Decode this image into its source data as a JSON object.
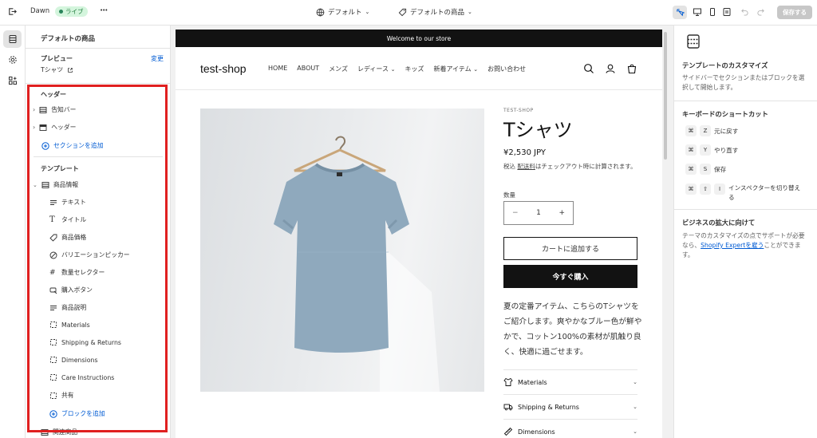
{
  "topbar": {
    "store_name": "Dawn",
    "live_label": "ライブ",
    "more_label": "•••",
    "theme_select": "デフォルト",
    "template_select": "デフォルトの商品",
    "save_label": "保存する"
  },
  "sidebar": {
    "title": "デフォルトの商品",
    "preview_label": "プレビュー",
    "preview_change": "変更",
    "preview_value": "Tシャツ",
    "header_group_label": "ヘッダー",
    "header_items": [
      {
        "label": "告知バー",
        "icon": "section-icon"
      },
      {
        "label": "ヘッダー",
        "icon": "header-section-icon"
      }
    ],
    "add_section_label": "セクションを追加",
    "template_group_label": "テンプレート",
    "product_info_label": "商品情報",
    "blocks": [
      {
        "label": "テキスト",
        "icon": "text-icon"
      },
      {
        "label": "タイトル",
        "icon": "title-icon"
      },
      {
        "label": "商品価格",
        "icon": "price-tag-icon"
      },
      {
        "label": "バリエーションピッカー",
        "icon": "variant-picker-icon"
      },
      {
        "label": "数量セレクター",
        "icon": "hash-icon"
      },
      {
        "label": "購入ボタン",
        "icon": "buy-button-icon"
      },
      {
        "label": "商品説明",
        "icon": "text-icon"
      },
      {
        "label": "Materials",
        "icon": "collapsible-icon"
      },
      {
        "label": "Shipping & Returns",
        "icon": "collapsible-icon"
      },
      {
        "label": "Dimensions",
        "icon": "collapsible-icon"
      },
      {
        "label": "Care Instructions",
        "icon": "collapsible-icon"
      },
      {
        "label": "共有",
        "icon": "collapsible-icon"
      }
    ],
    "add_block_label": "ブロックを追加",
    "related_label": "関連商品"
  },
  "preview": {
    "announcement": "Welcome to our store",
    "shop_name": "test-shop",
    "nav": [
      "HOME",
      "ABOUT",
      "メンズ",
      "レディース",
      "キッズ",
      "新着アイテム",
      "お問い合わせ"
    ],
    "nav_dropdown": [
      false,
      false,
      false,
      true,
      false,
      true,
      false
    ],
    "vendor": "TEST-SHOP",
    "product_title": "Tシャツ",
    "price": "¥2,530 JPY",
    "tax_note_pre": "税込",
    "tax_note_link": "配送料",
    "tax_note_post": "はチェックアウト時に計算されます。",
    "qty_label": "数量",
    "qty_minus": "−",
    "qty_value": "1",
    "qty_plus": "+",
    "add_to_cart": "カートに追加する",
    "buy_now": "今すぐ購入",
    "description": "夏の定番アイテム、こちらのTシャツをご紹介します。爽やかなブルー色が鮮やかで、コットン100%の素材が肌触り良く、快適に過ごせます。",
    "accordions": [
      {
        "label": "Materials",
        "icon": "materials-icon"
      },
      {
        "label": "Shipping & Returns",
        "icon": "truck-icon"
      },
      {
        "label": "Dimensions",
        "icon": "ruler-icon"
      }
    ]
  },
  "right_panel": {
    "customize_title": "テンプレートのカスタマイズ",
    "customize_text": "サイドバーでセクションまたはブロックを選択して開始します。",
    "shortcuts_title": "キーボードのショートカット",
    "shortcuts": [
      {
        "keys": [
          "⌘",
          "Z"
        ],
        "label": "元に戻す"
      },
      {
        "keys": [
          "⌘",
          "Y"
        ],
        "label": "やり直す"
      },
      {
        "keys": [
          "⌘",
          "S"
        ],
        "label": "保存"
      },
      {
        "keys": [
          "⌘",
          "⇧",
          "I"
        ],
        "label": "インスペクターを切り替える"
      }
    ],
    "business_title": "ビジネスの拡大に向けて",
    "business_text_pre": "テーマのカスタマイズの点でサポートが必要なら、",
    "business_link": "Shopify Expertを雇う",
    "business_text_post": "ことができます。"
  },
  "colors": {
    "accent": "#005bd3",
    "highlight_box": "#e02020",
    "live_badge_bg": "#d4f5dd",
    "button_dark": "#121212",
    "tshirt": "#8fa9bd"
  }
}
